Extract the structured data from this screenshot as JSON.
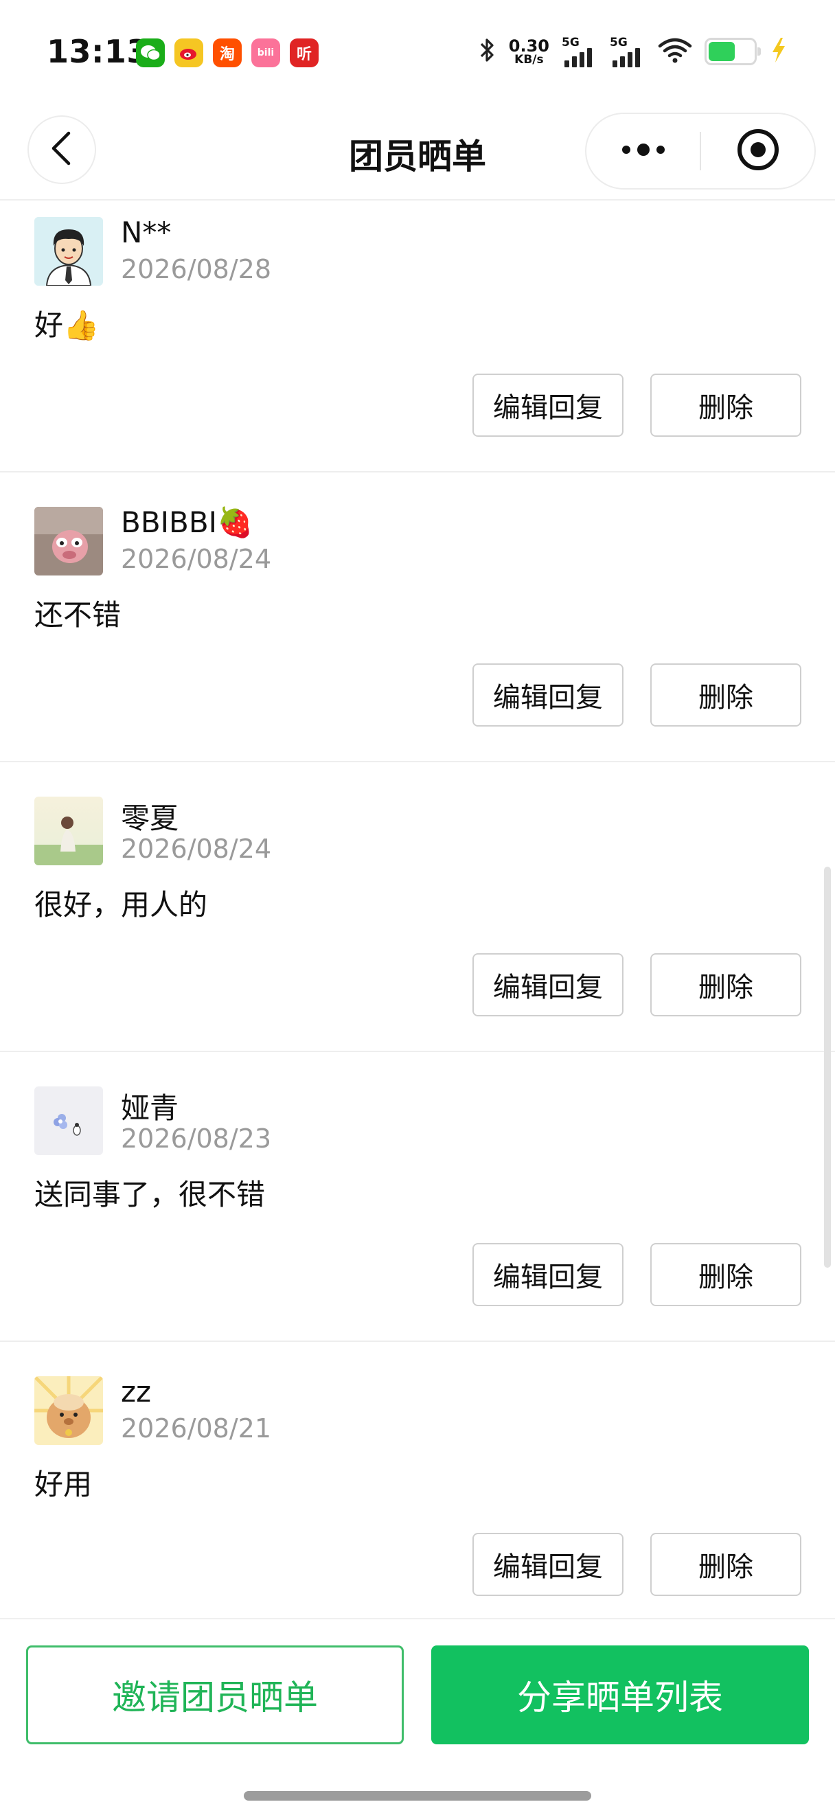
{
  "status_bar": {
    "time": "13:13",
    "net_speed_value": "0.30",
    "net_speed_unit": "KB/s",
    "signal_1_label": "5G",
    "signal_2_label": "5G",
    "battery_level": 0.6,
    "app_icons": [
      "wechat-icon",
      "weibo-icon",
      "taobao-icon",
      "bilibili-icon",
      "ting-icon"
    ],
    "taobao_glyph": "淘",
    "bilibili_glyph": "bili",
    "ting_glyph": "听"
  },
  "nav": {
    "title": "团员晒单"
  },
  "reviews": [
    {
      "name": "N**",
      "date": "2026/08/28",
      "comment": "好👍",
      "edit_label": "编辑回复",
      "delete_label": "删除"
    },
    {
      "name": "BBIBBI🍓",
      "date": "2026/08/24",
      "comment": "还不错",
      "edit_label": "编辑回复",
      "delete_label": "删除"
    },
    {
      "name": "零夏",
      "date": "2026/08/24",
      "comment": "很好，用人的",
      "edit_label": "编辑回复",
      "delete_label": "删除"
    },
    {
      "name": "娅青",
      "date": "2026/08/23",
      "comment": "送同事了，很不错",
      "edit_label": "编辑回复",
      "delete_label": "删除"
    },
    {
      "name": "zz",
      "date": "2026/08/21",
      "comment": "好用",
      "edit_label": "编辑回复",
      "delete_label": "删除"
    }
  ],
  "bottom": {
    "invite_label": "邀请团员晒单",
    "share_label": "分享晒单列表"
  },
  "colors": {
    "accent_green": "#12c160",
    "outline_green": "#3fbd6a"
  }
}
